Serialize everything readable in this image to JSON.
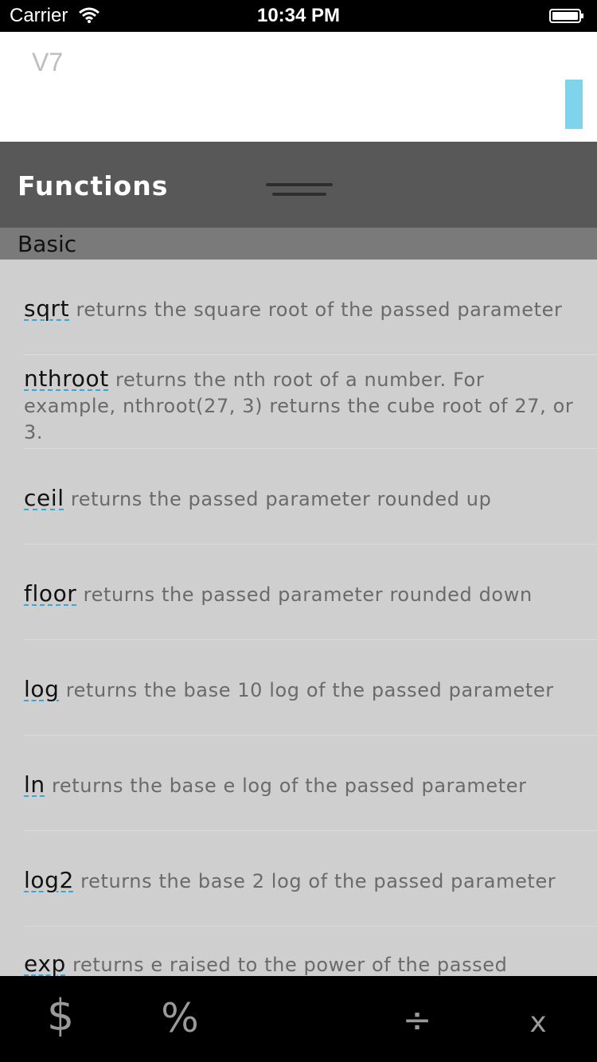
{
  "status": {
    "carrier": "Carrier",
    "time": "10:34 PM"
  },
  "display": {
    "expression": "V7"
  },
  "panel": {
    "title": "Functions",
    "section": "Basic"
  },
  "functions": [
    {
      "name": "sqrt",
      "desc": " returns the square root of the passed parameter"
    },
    {
      "name": "nthroot",
      "desc": " returns the nth root of a number. For example, nthroot(27, 3) returns the cube root of 27, or 3."
    },
    {
      "name": "ceil",
      "desc": " returns the passed parameter rounded up"
    },
    {
      "name": "floor",
      "desc": " returns the passed parameter rounded down"
    },
    {
      "name": "log",
      "desc": " returns the base 10 log of the passed parameter"
    },
    {
      "name": "ln",
      "desc": " returns the base e log of the passed parameter"
    },
    {
      "name": "log2",
      "desc": " returns the base 2 log of the passed parameter"
    },
    {
      "name": "exp",
      "desc": " returns e raised to the power of the passed"
    }
  ],
  "toolbar": {
    "dollar": "$",
    "percent": "%",
    "divide": "÷",
    "times": "x"
  },
  "colors": {
    "accent": "#7fd3ea",
    "header": "#585858",
    "list_bg": "#cfcfcf"
  }
}
